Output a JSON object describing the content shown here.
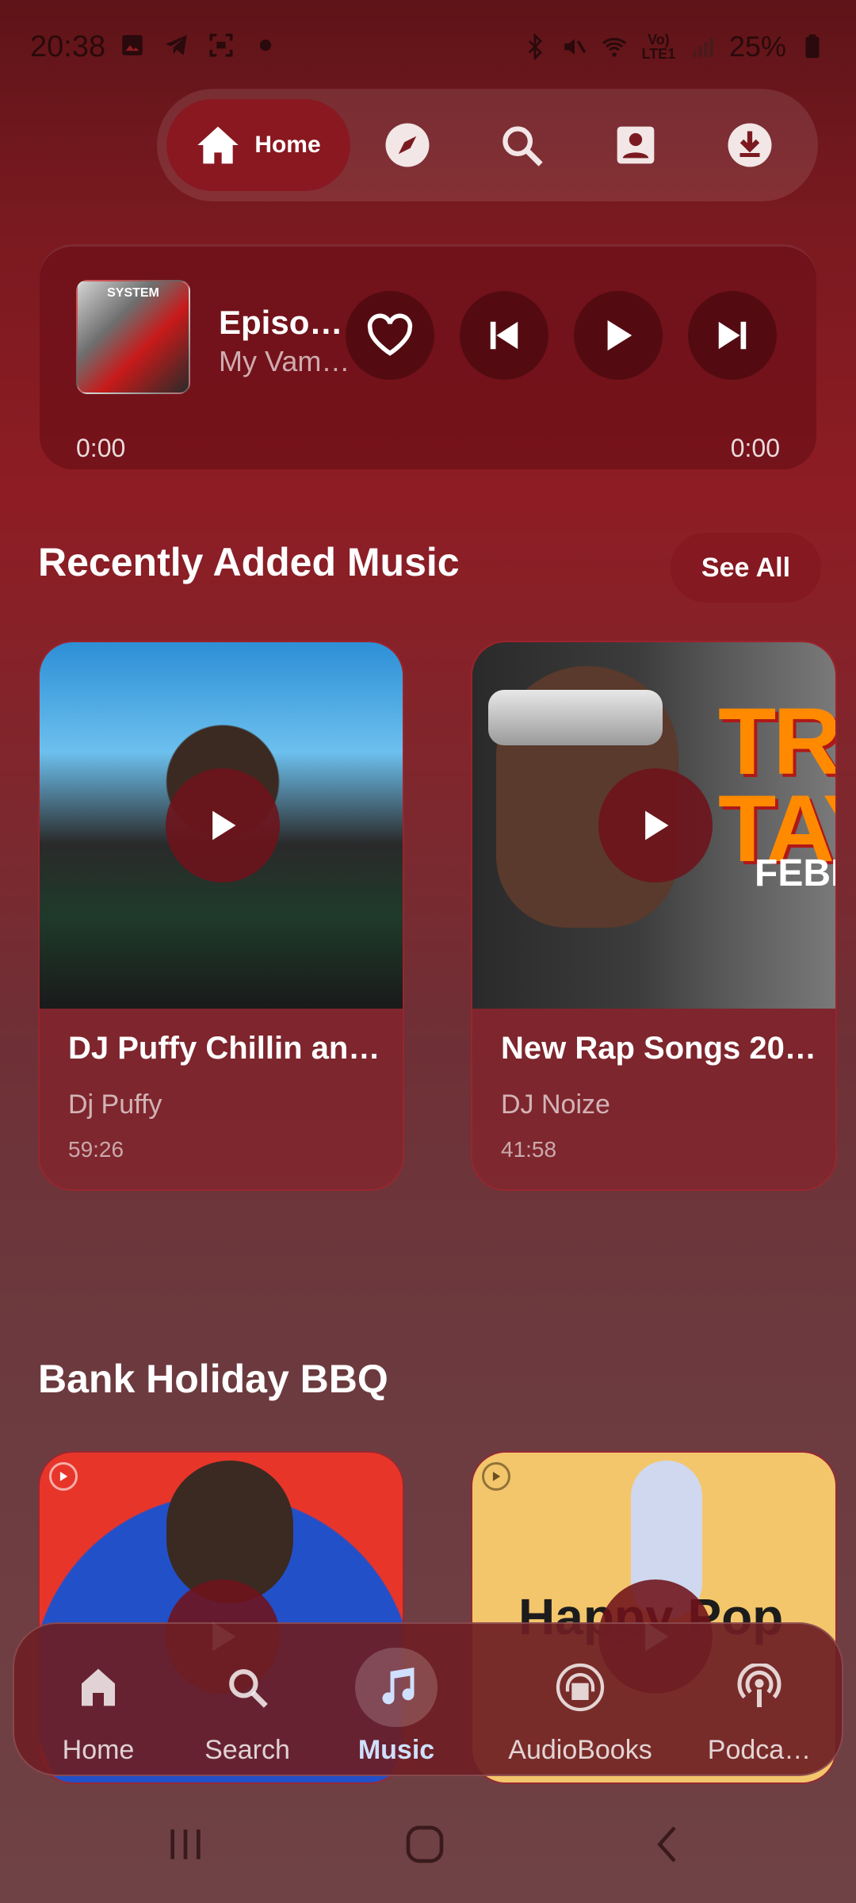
{
  "status_bar": {
    "time": "20:38",
    "battery": "25%",
    "network_label": "Vo) LTE1",
    "icons_left": [
      "image-icon",
      "telegram-icon",
      "screenshot-icon",
      "dot-icon"
    ],
    "icons_right": [
      "bluetooth-icon",
      "mute-icon",
      "wifi-icon",
      "signal-icon",
      "battery-icon"
    ]
  },
  "top_nav": {
    "home_label": "Home",
    "items": [
      "home-icon",
      "explore-icon",
      "search-icon",
      "account-icon",
      "download-icon"
    ]
  },
  "player": {
    "art_caption": "SYSTEM",
    "title": "Episo…",
    "artist": "My Vam…",
    "time_current": "0:00",
    "time_total": "0:00"
  },
  "sections": {
    "recent": {
      "title": "Recently Added Music",
      "see_all": "See All",
      "cards": [
        {
          "title": "DJ Puffy Chillin an…",
          "artist": "Dj Puffy",
          "duration": "59:26"
        },
        {
          "title": "New Rap Songs 20…",
          "artist": "DJ Noize",
          "duration": "41:58"
        }
      ]
    },
    "bbq": {
      "title": "Bank Holiday BBQ",
      "card2_text": "Happy Pop"
    }
  },
  "card_art": {
    "rap_banner": "TRA TAY",
    "rap_subtitle": "FEBR"
  },
  "bottom_nav": {
    "items": [
      {
        "label": "Home",
        "icon": "home-icon",
        "active": false
      },
      {
        "label": "Search",
        "icon": "search-icon",
        "active": false
      },
      {
        "label": "Music",
        "icon": "music-note-icon",
        "active": true
      },
      {
        "label": "AudioBooks",
        "icon": "audiobook-icon",
        "active": false
      },
      {
        "label": "Podca…",
        "icon": "podcast-icon",
        "active": false
      }
    ]
  },
  "colors": {
    "accent_active": "#cfe0ff",
    "background_top": "#5e1418",
    "background_mid": "#8e1c24",
    "background_bottom": "#6f4246"
  }
}
